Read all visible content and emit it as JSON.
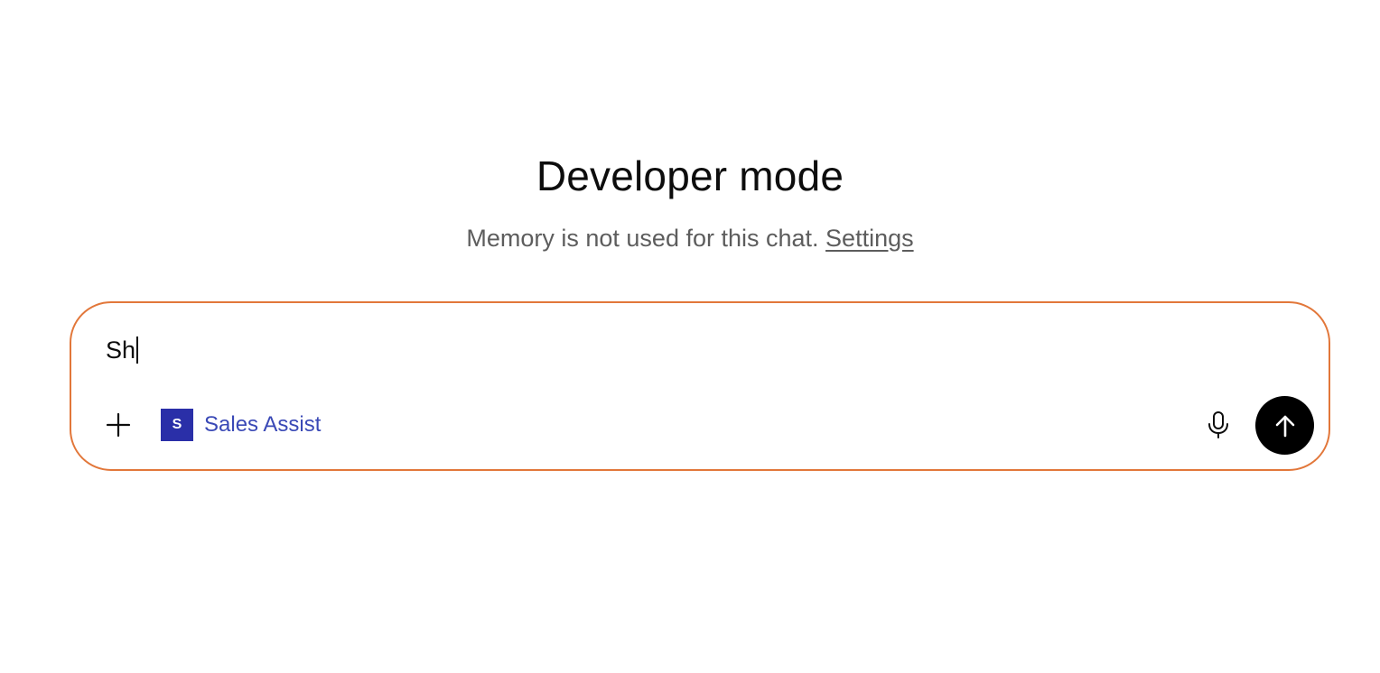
{
  "header": {
    "title": "Developer mode",
    "subtitle_text": "Memory is not used for this chat.",
    "settings_link": "Settings"
  },
  "composer": {
    "input_value": "Sh",
    "plus_icon": "plus-icon",
    "connector": {
      "logo_letter": "S",
      "label": "Sales Assist",
      "logo_color": "#2a2fa8",
      "label_color": "#3a49b6"
    },
    "mic_icon": "microphone-icon",
    "send_icon": "arrow-up-icon",
    "border_color": "#e2773a"
  }
}
